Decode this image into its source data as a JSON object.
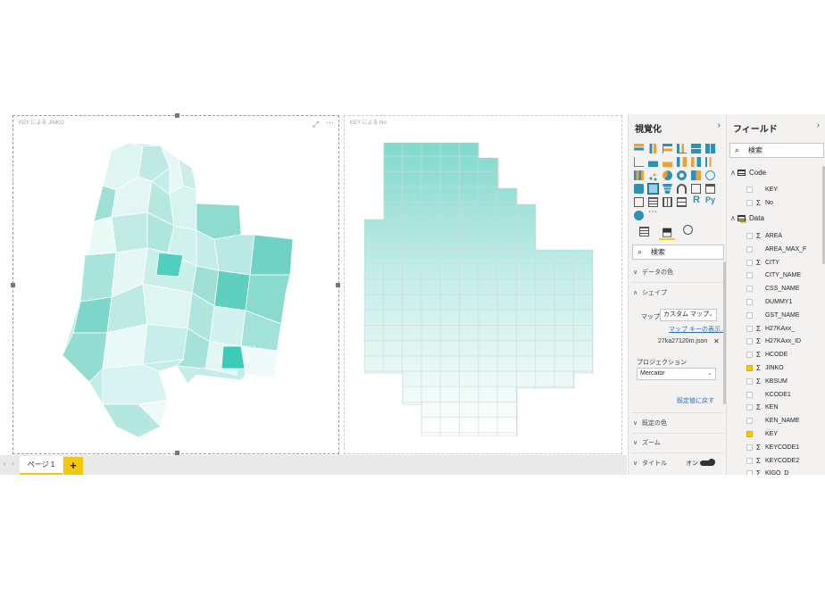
{
  "canvas": {
    "visual1_title": "KEY による JINKO",
    "visual2_title": "KEY による No"
  },
  "pagebar": {
    "page_tab": "ページ 1",
    "add_page": "+"
  },
  "viz_pane": {
    "title": "視覚化",
    "search_placeholder": "検索",
    "sections": {
      "data_colors": "データの色",
      "shape": "シェイプ",
      "default_colors": "既定の色",
      "zoom": "ズーム",
      "title": "タイトル"
    },
    "map_label": "マップ",
    "map_value": "カスタム マップ",
    "map_keys_link": "マップ キーの表示...",
    "map_file": "27ka27120m.json",
    "projection_label": "プロジェクション",
    "projection_value": "Mercator",
    "reset_link": "既定値に戻す",
    "title_toggle": "オン"
  },
  "field_pane": {
    "title": "フィールド",
    "search_placeholder": "検索",
    "groups": [
      {
        "name": "Code",
        "fields": [
          {
            "name": "KEY",
            "sigma": false,
            "checked": false
          },
          {
            "name": "No",
            "sigma": true,
            "checked": false
          }
        ]
      },
      {
        "name": "Data",
        "fields": [
          {
            "name": "AREA",
            "sigma": true,
            "checked": false
          },
          {
            "name": "AREA_MAX_F",
            "sigma": false,
            "checked": false
          },
          {
            "name": "CITY",
            "sigma": true,
            "checked": false
          },
          {
            "name": "CITY_NAME",
            "sigma": false,
            "checked": false
          },
          {
            "name": "CSS_NAME",
            "sigma": false,
            "checked": false
          },
          {
            "name": "DUMMY1",
            "sigma": false,
            "checked": false
          },
          {
            "name": "GST_NAME",
            "sigma": false,
            "checked": false
          },
          {
            "name": "H27KAxx_",
            "sigma": true,
            "checked": false
          },
          {
            "name": "H27KAxx_ID",
            "sigma": true,
            "checked": false
          },
          {
            "name": "HCODE",
            "sigma": true,
            "checked": false
          },
          {
            "name": "JINKO",
            "sigma": true,
            "checked": true
          },
          {
            "name": "KBSUM",
            "sigma": true,
            "checked": false
          },
          {
            "name": "KCODE1",
            "sigma": false,
            "checked": false
          },
          {
            "name": "KEN",
            "sigma": true,
            "checked": false
          },
          {
            "name": "KEN_NAME",
            "sigma": false,
            "checked": false
          },
          {
            "name": "KEY",
            "sigma": false,
            "checked": true
          },
          {
            "name": "KEYCODE1",
            "sigma": true,
            "checked": false
          },
          {
            "name": "KEYCODE2",
            "sigma": true,
            "checked": false
          },
          {
            "name": "KIGO_D",
            "sigma": true,
            "checked": false
          }
        ]
      }
    ]
  },
  "colors": {
    "accent": "#f2c811",
    "map_dark": "#3fcdb9",
    "map_light": "#effbf9"
  }
}
